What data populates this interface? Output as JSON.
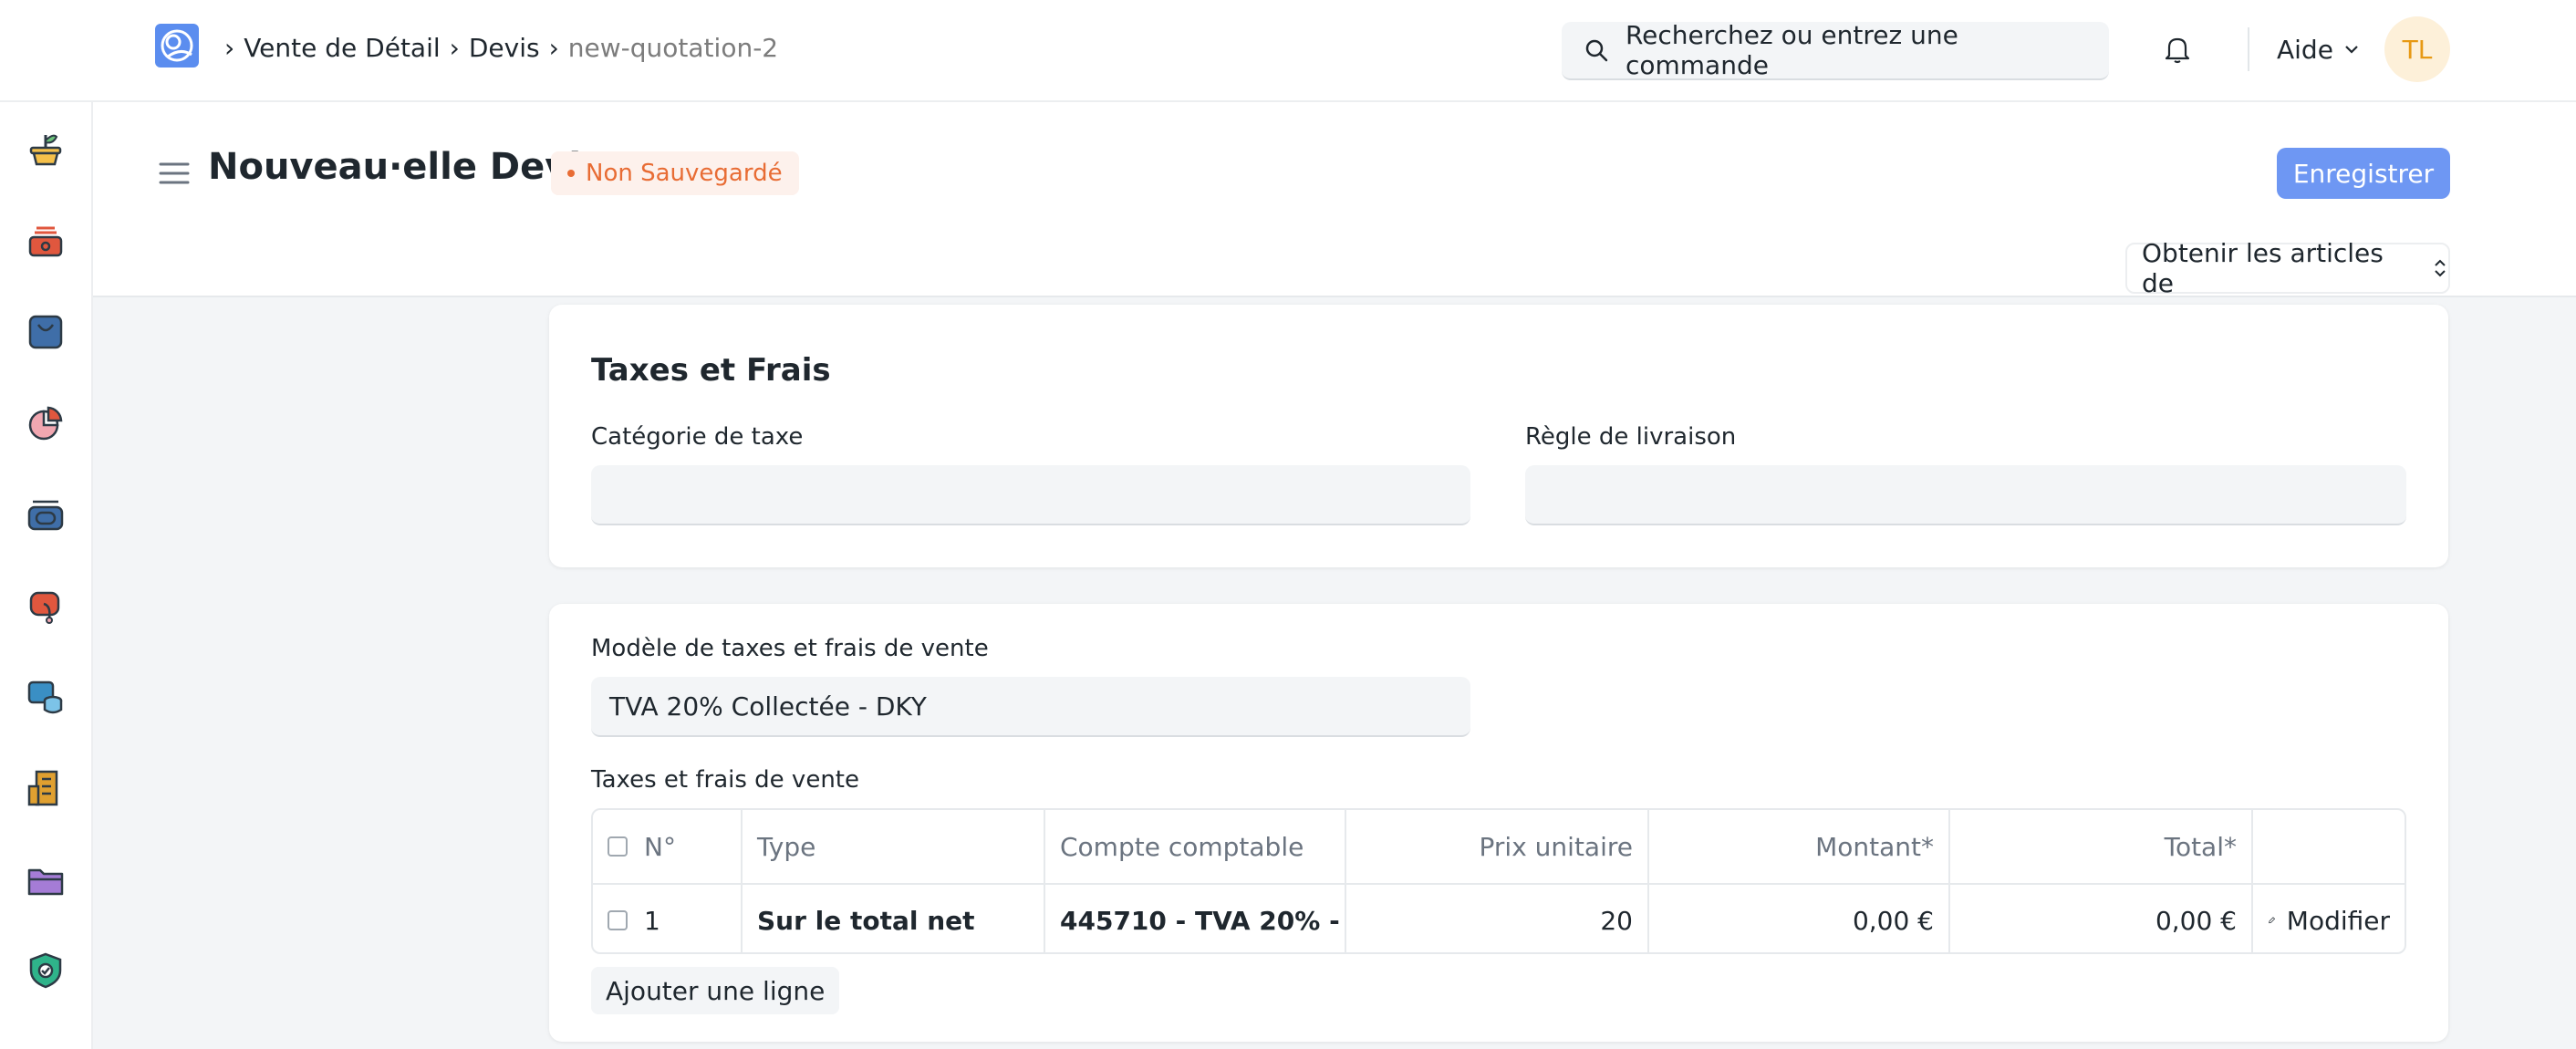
{
  "navbar": {
    "breadcrumbs": [
      "Vente de Détail",
      "Devis",
      "new-quotation-2"
    ],
    "search_placeholder": "Recherchez ou entrez une commande",
    "help_label": "Aide",
    "avatar_initials": "TL"
  },
  "sidebar": {
    "icons": [
      "plant-pot-icon",
      "cash-box-icon",
      "shopping-bag-icon",
      "pie-chart-icon",
      "desk-tray-icon",
      "support-icon",
      "database-icon",
      "building-icon",
      "folder-icon",
      "shield-check-icon"
    ]
  },
  "page": {
    "title": "Nouveau·elle Devis",
    "status": "Non Sauvegardé",
    "save_label": "Enregistrer",
    "get_items_label": "Obtenir les articles de"
  },
  "taxes_section": {
    "title": "Taxes et Frais",
    "tax_category_label": "Catégorie de taxe",
    "tax_category_value": "",
    "shipping_rule_label": "Règle de livraison",
    "shipping_rule_value": ""
  },
  "template_section": {
    "template_label": "Modèle de taxes et frais de vente",
    "template_value": "TVA 20% Collectée - DKY",
    "table_label": "Taxes et frais de vente",
    "columns": [
      "N°",
      "Type",
      "Compte comptable",
      "Prix unitaire",
      "Montant*",
      "Total*"
    ],
    "rows": [
      {
        "no": "1",
        "type": "Sur le total net",
        "account": "445710 - TVA 20% - …",
        "rate": "20",
        "amount": "0,00 €",
        "total": "0,00 €",
        "edit": "Modifier"
      }
    ],
    "add_row_label": "Ajouter une ligne"
  },
  "colors": {
    "primary": "#6e97f3",
    "status_text": "#e86c34",
    "status_bg": "#fdf1ec",
    "avatar_text": "#e79913",
    "avatar_bg": "#fdf0d9"
  }
}
